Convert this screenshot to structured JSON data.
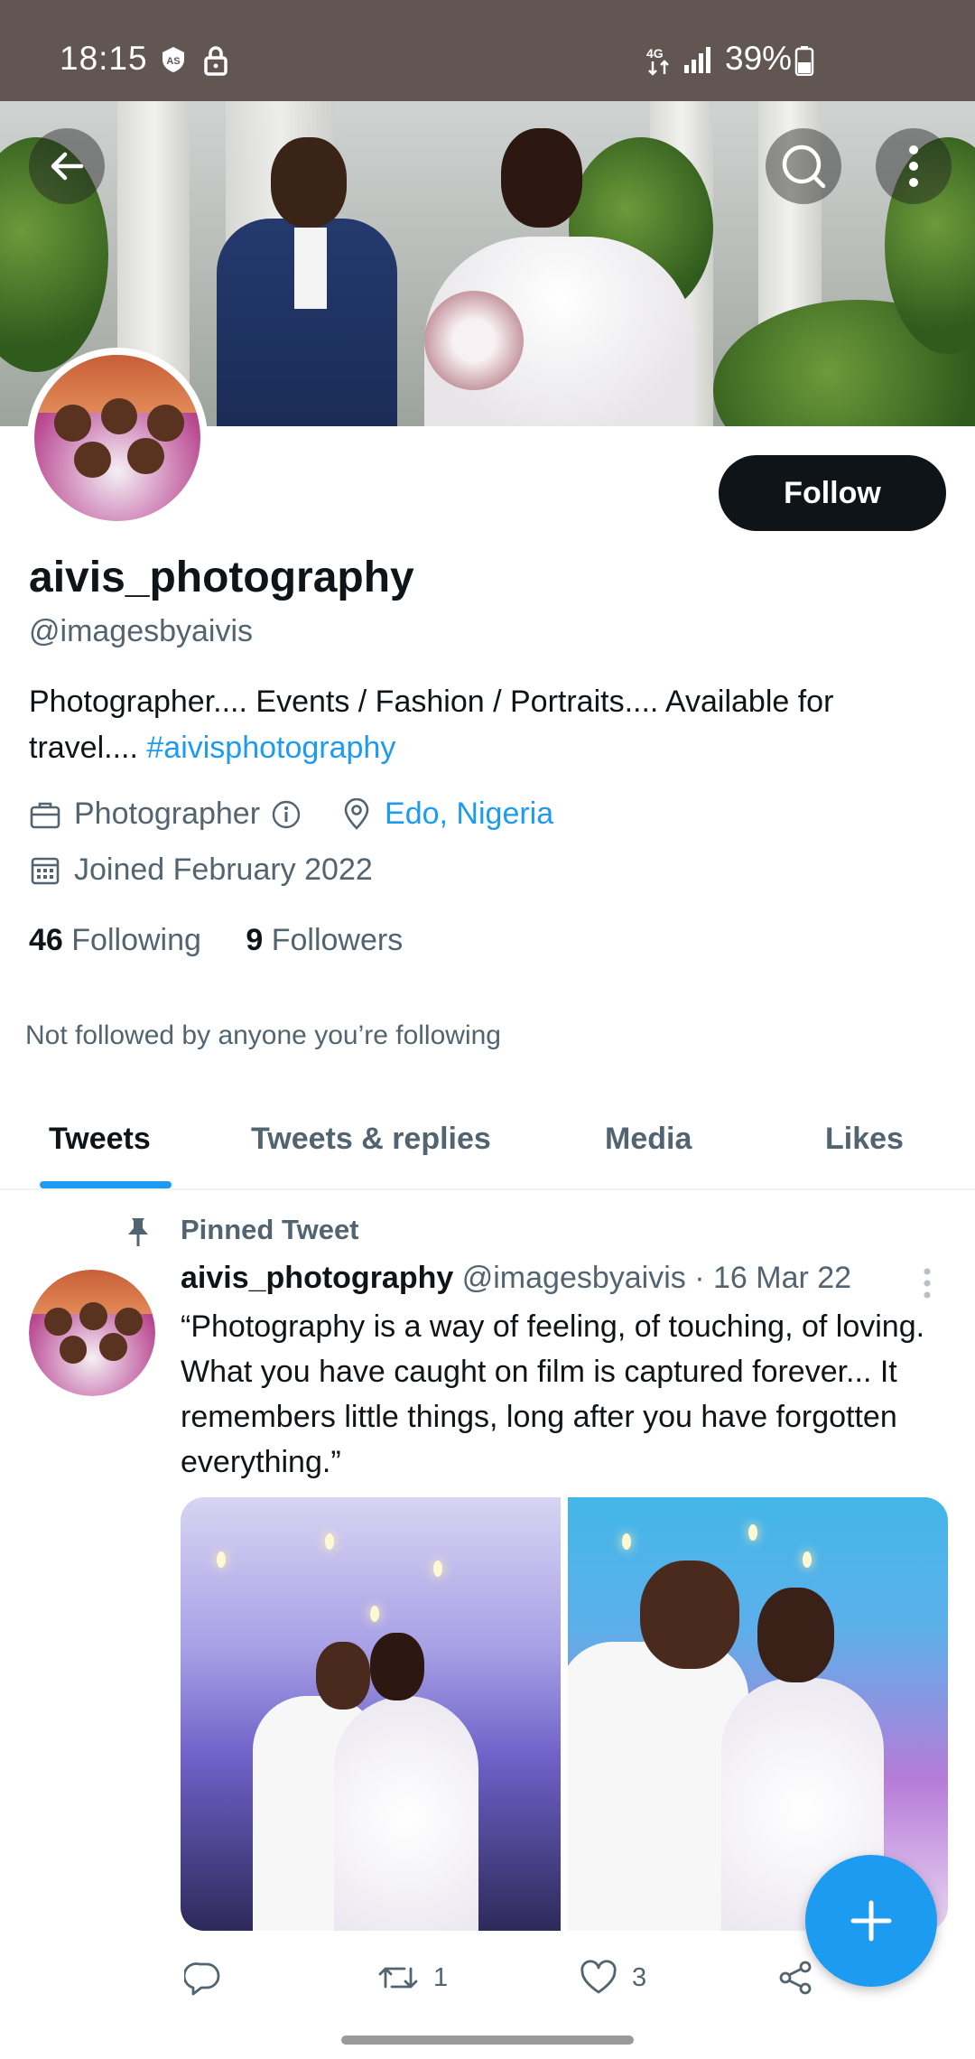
{
  "status_bar": {
    "time": "18:15",
    "battery": "39%",
    "icons": [
      "as-badge-icon",
      "lock-icon",
      "4g-data-icon",
      "signal-icon",
      "battery-icon"
    ]
  },
  "header": {
    "icons": [
      "back-arrow-icon",
      "search-icon",
      "more-vertical-icon"
    ]
  },
  "profile": {
    "display_name": "aivis_photography",
    "handle": "@imagesbyaivis",
    "follow_label": "Follow",
    "bio_text": "Photographer.... Events / Fashion / Portraits.... Available for travel.... ",
    "bio_hashtag": "#aivisphotography",
    "category": "Photographer",
    "location": "Edo, Nigeria",
    "joined": "Joined February 2022",
    "following_count": "46",
    "following_label": "Following",
    "followers_count": "9",
    "followers_label": "Followers",
    "not_followed_text": "Not followed by anyone you’re following"
  },
  "tabs": [
    {
      "label": "Tweets",
      "active": true
    },
    {
      "label": "Tweets & replies",
      "active": false
    },
    {
      "label": "Media",
      "active": false
    },
    {
      "label": "Likes",
      "active": false
    }
  ],
  "tweet": {
    "pinned_label": "Pinned Tweet",
    "author_name": "aivis_photography",
    "author_handle": "@imagesbyaivis",
    "date": "· 16 Mar 22",
    "text": "“Photography is a way of feeling, of touching, of loving. What you have caught on film is captured forever... It remembers little things, long after you have forgotten everything.”",
    "reply_count": "",
    "retweet_count": "1",
    "like_count": "3"
  },
  "colors": {
    "accent": "#1d9bf0",
    "text_primary": "#0f1419",
    "text_secondary": "#536471",
    "status_bar_bg": "#615652"
  }
}
